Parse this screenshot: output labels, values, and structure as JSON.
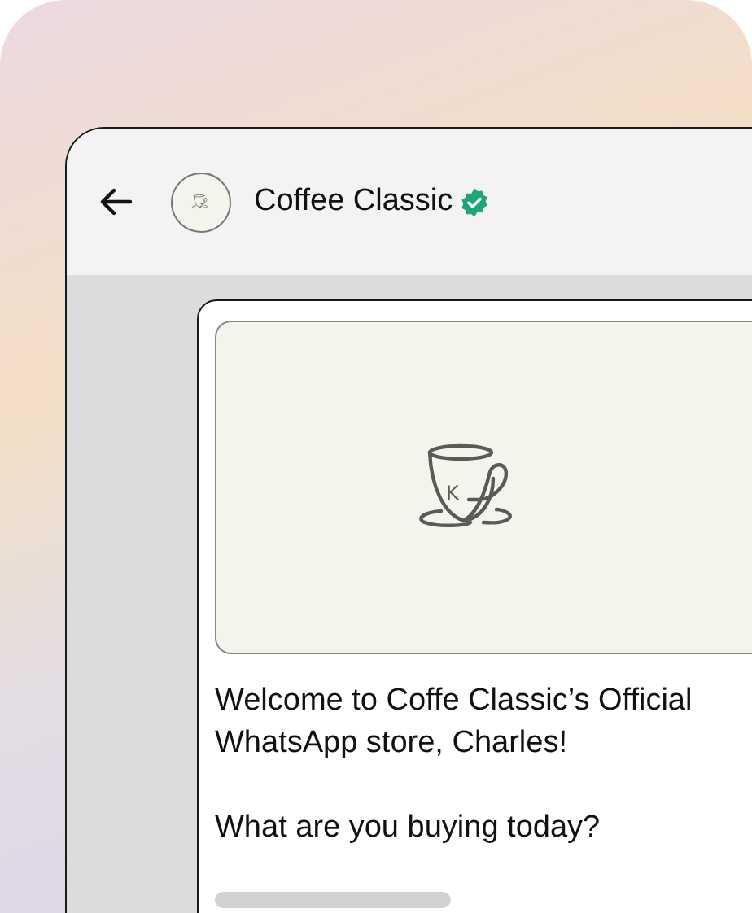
{
  "header": {
    "title": "Coffee Classic",
    "verified": true
  },
  "message": {
    "logo_letter": "K",
    "text_lines": [
      "Welcome to Coffe Classic’s Official",
      "WhatsApp store, Charles!"
    ],
    "question": "What are you buying today?"
  }
}
